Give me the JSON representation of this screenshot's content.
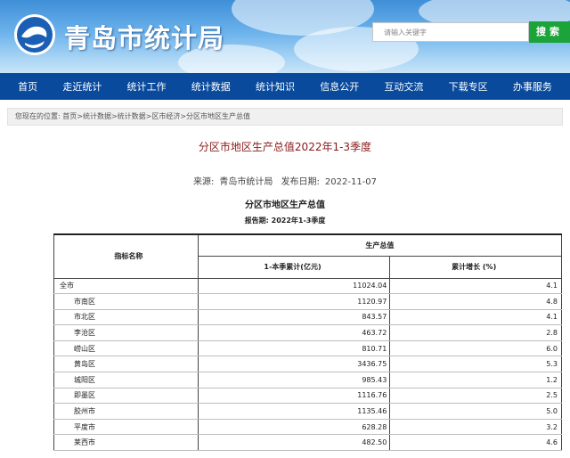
{
  "header": {
    "site_title": "青岛市统计局",
    "search_placeholder": "请输入关键字",
    "search_button": "搜索"
  },
  "nav": {
    "items": [
      "首页",
      "走近统计",
      "统计工作",
      "统计数据",
      "统计知识",
      "信息公开",
      "互动交流",
      "下载专区",
      "办事服务"
    ]
  },
  "breadcrumb": "您现在的位置: 首页>统计数据>统计数据>区市经济>分区市地区生产总值",
  "article": {
    "title": "分区市地区生产总值2022年1-3季度",
    "source_label": "来源:",
    "source_value": "青岛市统计局",
    "date_label": "发布日期:",
    "date_value": "2022-11-07",
    "table_title": "分区市地区生产总值",
    "report_period": "报告期: 2022年1-3季度"
  },
  "table": {
    "col_indicator": "指标名称",
    "col_group": "生产总值",
    "col_cumulative": "1-本季累计(亿元)",
    "col_growth": "累计增长 (%)",
    "rows": [
      {
        "name": "全市",
        "value": "11024.04",
        "growth": "4.1",
        "indent": false
      },
      {
        "name": "市南区",
        "value": "1120.97",
        "growth": "4.8",
        "indent": true
      },
      {
        "name": "市北区",
        "value": "843.57",
        "growth": "4.1",
        "indent": true
      },
      {
        "name": "李沧区",
        "value": "463.72",
        "growth": "2.8",
        "indent": true
      },
      {
        "name": "崂山区",
        "value": "810.71",
        "growth": "6.0",
        "indent": true
      },
      {
        "name": "黄岛区",
        "value": "3436.75",
        "growth": "5.3",
        "indent": true
      },
      {
        "name": "城阳区",
        "value": "985.43",
        "growth": "1.2",
        "indent": true
      },
      {
        "name": "即墨区",
        "value": "1116.76",
        "growth": "2.5",
        "indent": true
      },
      {
        "name": "胶州市",
        "value": "1135.46",
        "growth": "5.0",
        "indent": true
      },
      {
        "name": "平度市",
        "value": "628.28",
        "growth": "3.2",
        "indent": true
      },
      {
        "name": "莱西市",
        "value": "482.50",
        "growth": "4.6",
        "indent": true
      }
    ]
  }
}
